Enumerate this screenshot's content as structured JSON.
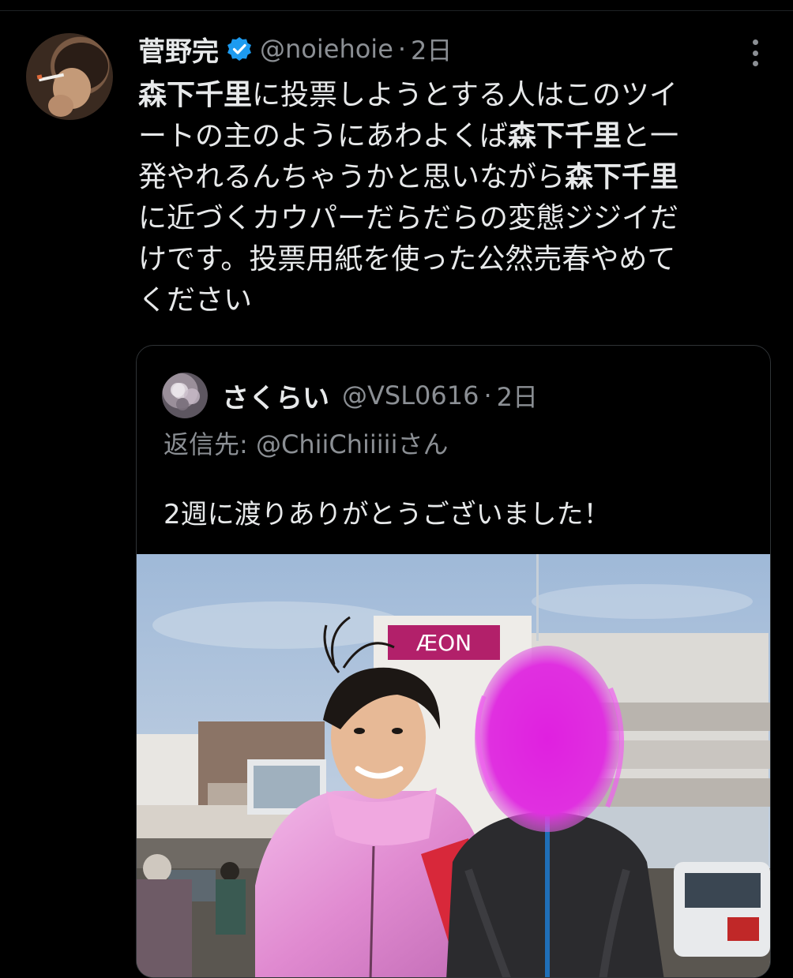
{
  "tweet": {
    "author_name": "菅野完",
    "handle": "@noiehoie",
    "separator": "·",
    "date": "2日",
    "lines": [
      [
        {
          "t": "森下千里",
          "b": true
        },
        {
          "t": "に投票しようとする人はこのツイ",
          "b": false
        }
      ],
      [
        {
          "t": "ートの主のようにあわよくば",
          "b": false
        },
        {
          "t": "森下千里",
          "b": true
        },
        {
          "t": "と一",
          "b": false
        }
      ],
      [
        {
          "t": "発やれるんちゃうかと思いながら",
          "b": false
        },
        {
          "t": "森下千里",
          "b": true
        }
      ],
      [
        {
          "t": "に近づくカウパーだらだらの変態ジジイだ",
          "b": false
        }
      ],
      [
        {
          "t": "けです。投票用紙を使った公然売春やめて",
          "b": false
        }
      ],
      [
        {
          "t": "ください",
          "b": false
        }
      ]
    ]
  },
  "quoted": {
    "author_name": "さくらい",
    "handle": "@VSL0616",
    "separator": "·",
    "date": "2日",
    "reply_prefix": "返信先: ",
    "reply_mention": "@ChiiChiiiiiさん",
    "text": "2週に渡りありがとうございました！",
    "photo": {
      "store_sign": "ÆON"
    }
  },
  "icons": {
    "verified": "verified-badge-icon",
    "more": "more-options-icon"
  },
  "colors": {
    "background": "#000000",
    "text": "#e7e9ea",
    "secondary": "#8b8f94",
    "verified": "#1d9bf0",
    "border": "#2f3336",
    "blur_mask": "#e020e0"
  }
}
